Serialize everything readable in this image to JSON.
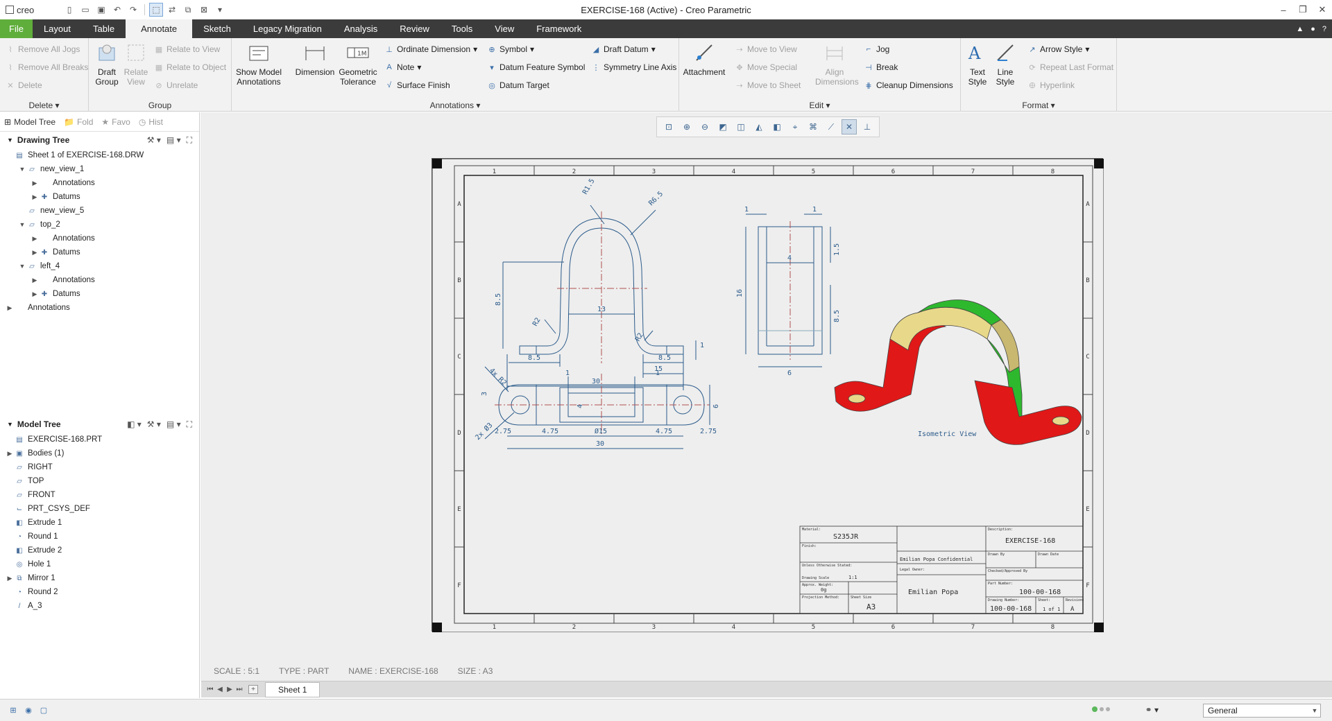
{
  "app": {
    "brand": "creo",
    "title": "EXERCISE-168 (Active) - Creo Parametric"
  },
  "ribbon_tabs": [
    "File",
    "Layout",
    "Table",
    "Annotate",
    "Sketch",
    "Legacy Migration",
    "Analysis",
    "Review",
    "Tools",
    "View",
    "Framework"
  ],
  "ribbon": {
    "delete_group": {
      "label": "Delete",
      "items": [
        "Remove All Jogs",
        "Remove All Breaks",
        "Delete"
      ]
    },
    "group_group": {
      "label": "Group",
      "draft_group": "Draft Group",
      "relate_view": "Relate View",
      "items": [
        "Relate to View",
        "Relate to Object",
        "Unrelate"
      ]
    },
    "annotations_group": {
      "label": "Annotations",
      "show_model": "Show Model Annotations",
      "dimension": "Dimension",
      "geometric_tolerance": "Geometric Tolerance",
      "col1": [
        "Ordinate Dimension",
        "Note",
        "Surface Finish"
      ],
      "col2": [
        "Symbol",
        "Datum Feature Symbol",
        "Datum Target"
      ],
      "col3": [
        "Draft Datum",
        "Symmetry Line Axis"
      ]
    },
    "edit_group": {
      "label": "Edit",
      "attachment": "Attachment",
      "move": [
        "Move to View",
        "Move Special",
        "Move to Sheet"
      ],
      "align": "Align Dimensions",
      "items": [
        "Jog",
        "Break",
        "Cleanup Dimensions"
      ]
    },
    "format_group": {
      "label": "Format",
      "text_style": "Text Style",
      "line_style": "Line Style",
      "items": [
        "Arrow Style",
        "Repeat Last Format",
        "Hyperlink"
      ]
    }
  },
  "left_panel": {
    "tabs": [
      "Model Tree",
      "Fold",
      "Favo",
      "Hist"
    ],
    "drawing_tree": {
      "title": "Drawing Tree",
      "nodes": [
        {
          "label": "Sheet 1 of EXERCISE-168.DRW",
          "level": 0,
          "tw": ""
        },
        {
          "label": "new_view_1",
          "level": 1,
          "tw": "▼"
        },
        {
          "label": "Annotations",
          "level": 2,
          "tw": "▶"
        },
        {
          "label": "Datums",
          "level": 2,
          "tw": "▶"
        },
        {
          "label": "new_view_5",
          "level": 1,
          "tw": ""
        },
        {
          "label": "top_2",
          "level": 1,
          "tw": "▼"
        },
        {
          "label": "Annotations",
          "level": 2,
          "tw": "▶"
        },
        {
          "label": "Datums",
          "level": 2,
          "tw": "▶"
        },
        {
          "label": "left_4",
          "level": 1,
          "tw": "▼"
        },
        {
          "label": "Annotations",
          "level": 2,
          "tw": "▶"
        },
        {
          "label": "Datums",
          "level": 2,
          "tw": "▶"
        },
        {
          "label": "Annotations",
          "level": 0,
          "tw": "▶"
        }
      ]
    },
    "model_tree": {
      "title": "Model Tree",
      "nodes": [
        {
          "label": "EXERCISE-168.PRT",
          "tw": ""
        },
        {
          "label": "Bodies (1)",
          "tw": "▶"
        },
        {
          "label": "RIGHT",
          "tw": ""
        },
        {
          "label": "TOP",
          "tw": ""
        },
        {
          "label": "FRONT",
          "tw": ""
        },
        {
          "label": "PRT_CSYS_DEF",
          "tw": ""
        },
        {
          "label": "Extrude 1",
          "tw": ""
        },
        {
          "label": "Round 1",
          "tw": ""
        },
        {
          "label": "Extrude 2",
          "tw": ""
        },
        {
          "label": "Hole 1",
          "tw": ""
        },
        {
          "label": "Mirror 1",
          "tw": "▶"
        },
        {
          "label": "Round 2",
          "tw": ""
        },
        {
          "label": "A_3",
          "tw": ""
        }
      ]
    }
  },
  "drawing": {
    "col_numbers": [
      "1",
      "2",
      "3",
      "4",
      "5",
      "6",
      "7",
      "8"
    ],
    "row_letters": [
      "A",
      "B",
      "C",
      "D",
      "E",
      "F"
    ],
    "front_view_dims": [
      "R1.5",
      "R6.5",
      "13",
      "8.5",
      "R2",
      "R2",
      "8.5",
      "8.5",
      "15",
      "30",
      "1"
    ],
    "side_view_dims": [
      "1",
      "1",
      "4",
      "1.5",
      "16",
      "8.5",
      "6"
    ],
    "top_view_dims": [
      "4x R2",
      "3",
      "2x Ø3",
      "1",
      "1",
      "4",
      "6",
      "2.75",
      "4.75",
      "Ø15",
      "4.75",
      "2.75",
      "30"
    ],
    "isometric_label": "Isometric View",
    "title_block": {
      "material_label": "Material:",
      "material": "S235JR",
      "finish_label": "Finish:",
      "tolerances_label": "Unless Otherwise Stated:",
      "scale_label": "Drawing Scale",
      "scale": "1:1",
      "weight_label": "Approx. Weight:",
      "weight": "0g",
      "projection_label": "Projection Method:",
      "sheet_size_label": "Sheet Size",
      "sheet_size": "A3",
      "legal_label": "Legal Owner:",
      "author": "Emilian Popa",
      "confidential": "Emilian Popa Confidential",
      "description_label": "Description:",
      "description": "EXERCISE-168",
      "drawn_by_label": "Drawn By",
      "date_label": "Drawn Date",
      "checked_label": "Checked/Approved By",
      "checked_date_label": "Checked/Approved Date",
      "part_number_label": "Part Number:",
      "part_number": "100-00-168",
      "drawing_number_label": "Drawing Number:",
      "drawing_number": "100-00-168",
      "sheet_label": "Sheet:",
      "sheet": "1 of 1",
      "revision_label": "Revision:",
      "revision": "A"
    }
  },
  "status_line": {
    "scale": "SCALE : 5:1",
    "type": "TYPE : PART",
    "name": "NAME : EXERCISE-168",
    "size": "SIZE : A3"
  },
  "sheet_tab": "Sheet 1",
  "filter": "General",
  "colors": {
    "ribbon_dark": "#3b3b3b",
    "file_tab": "#5fae3b",
    "drawing_line": "#2a5a8a",
    "iso_red": "#e01818",
    "iso_green": "#2eb82e",
    "iso_cream": "#e8d88a"
  }
}
